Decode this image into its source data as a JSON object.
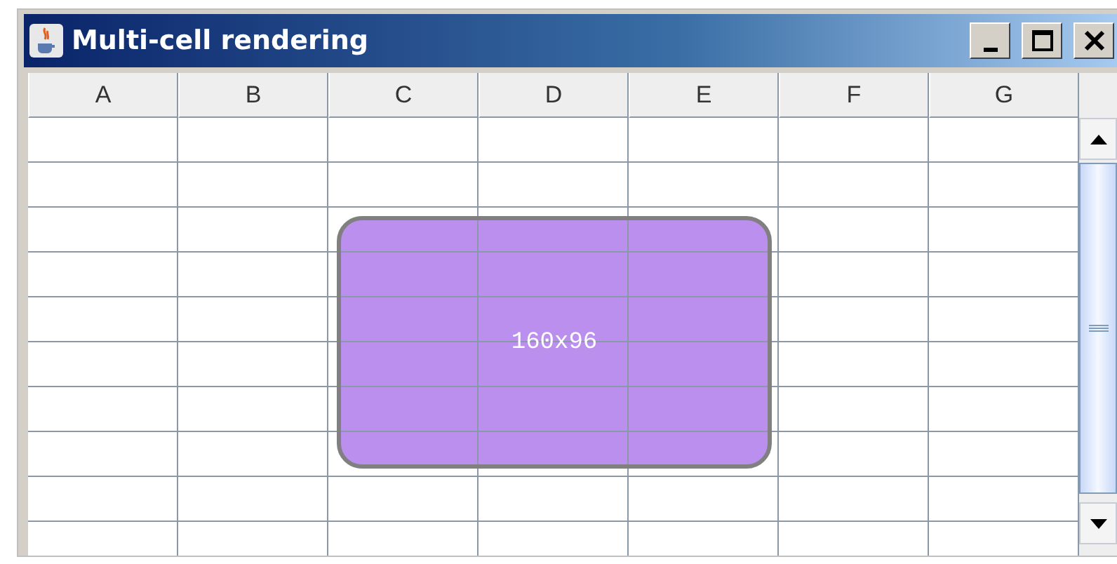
{
  "window": {
    "title": "Multi-cell rendering"
  },
  "table": {
    "columns": [
      "A",
      "B",
      "C",
      "D",
      "E",
      "F",
      "G"
    ],
    "overlay": {
      "kind": "rounded-rect",
      "label": "160x96"
    }
  }
}
